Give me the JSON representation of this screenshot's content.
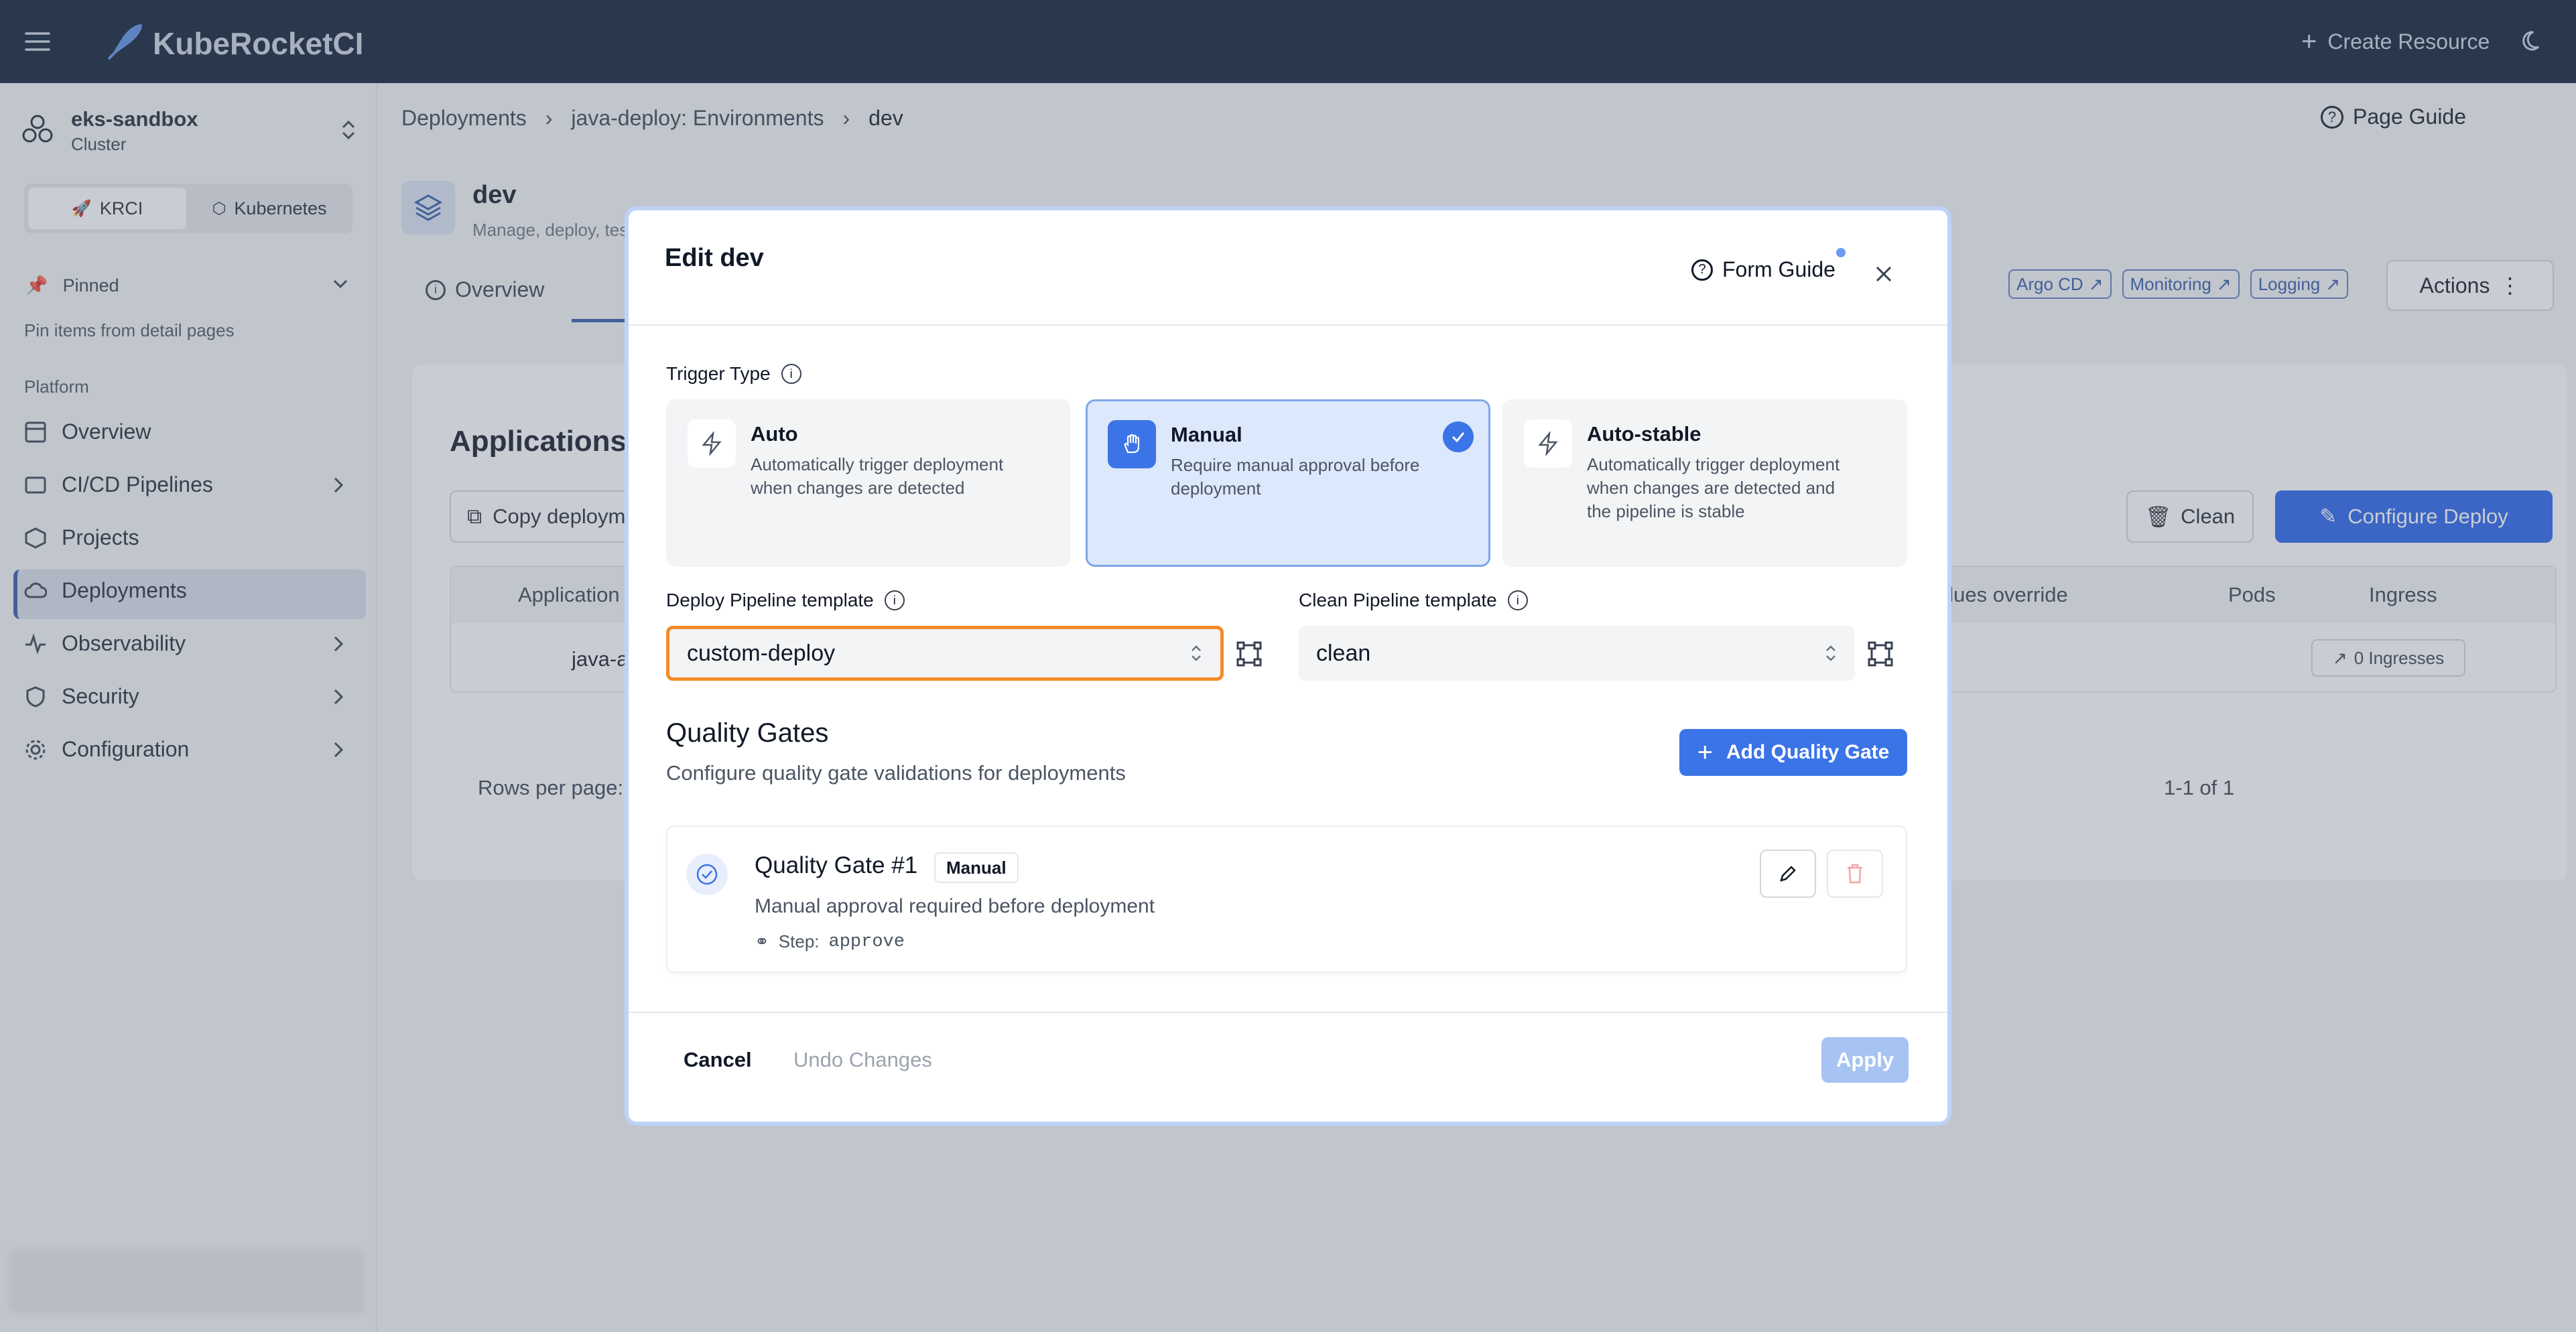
{
  "app": {
    "title": "KubeRocketCI",
    "create_resource": "Create Resource"
  },
  "cluster": {
    "name": "eks-sandbox",
    "type": "Cluster"
  },
  "sidebar": {
    "tabs": [
      "KRCI",
      "Kubernetes"
    ],
    "pinned_label": "Pinned",
    "pinned_hint": "Pin items from detail pages",
    "section": "Platform",
    "items": [
      {
        "label": "Overview"
      },
      {
        "label": "CI/CD Pipelines"
      },
      {
        "label": "Projects"
      },
      {
        "label": "Deployments"
      },
      {
        "label": "Observability"
      },
      {
        "label": "Security"
      },
      {
        "label": "Configuration"
      }
    ]
  },
  "breadcrumb": [
    "Deployments",
    "java-deploy: Environments",
    "dev"
  ],
  "page_guide": "Page Guide",
  "env": {
    "name": "dev",
    "description": "Manage, deploy, tes"
  },
  "links": [
    "Argo CD",
    "Monitoring",
    "Logging"
  ],
  "actions": "Actions",
  "tabs": [
    "Overview"
  ],
  "applications": {
    "title": "Applications",
    "copy_button": "Copy deploym",
    "clean_button": "Clean",
    "configure_button": "Configure Deploy",
    "columns": [
      "Application",
      "alues override",
      "Pods",
      "Ingress"
    ],
    "row_app": "java-a",
    "ingresses": "0 Ingresses",
    "rows_per_page": "Rows per page:",
    "range": "1-1 of 1"
  },
  "modal": {
    "title": "Edit dev",
    "form_guide": "Form Guide",
    "trigger_label": "Trigger Type",
    "triggers": [
      {
        "title": "Auto",
        "desc": "Automatically trigger deployment when changes are detected"
      },
      {
        "title": "Manual",
        "desc": "Require manual approval before deployment"
      },
      {
        "title": "Auto-stable",
        "desc": "Automatically trigger deployment when changes are detected and the pipeline is stable"
      }
    ],
    "deploy_label": "Deploy Pipeline template",
    "deploy_value": "custom-deploy",
    "clean_label": "Clean Pipeline template",
    "clean_value": "clean",
    "qg_title": "Quality Gates",
    "qg_desc": "Configure quality gate validations for deployments",
    "add_qg": "Add Quality Gate",
    "gate": {
      "name": "Quality Gate #1",
      "badge": "Manual",
      "desc": "Manual approval required before deployment",
      "step_label": "Step:",
      "step_value": "approve"
    },
    "cancel": "Cancel",
    "undo": "Undo Changes",
    "apply": "Apply"
  }
}
